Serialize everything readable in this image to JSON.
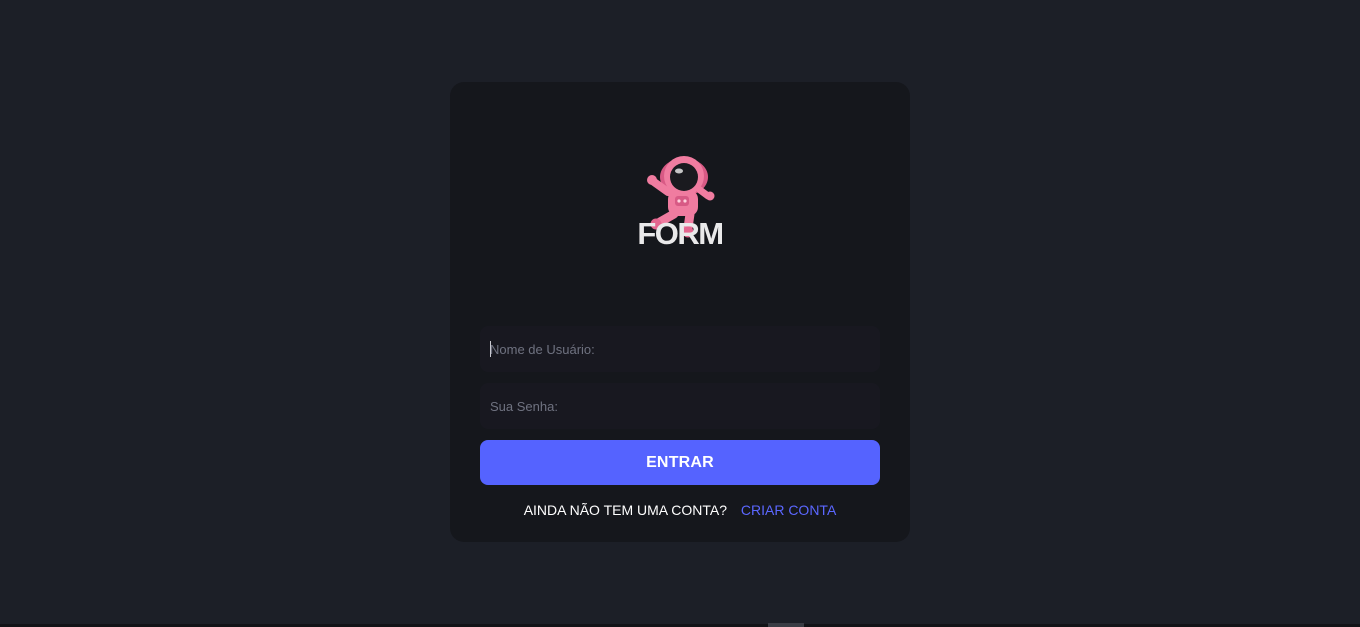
{
  "logo": {
    "icon": "astronaut-icon",
    "text": "FORM",
    "accent_color": "#f07ca0"
  },
  "form": {
    "username_placeholder": "Nome de Usuário:",
    "password_placeholder": "Sua Senha:",
    "submit_label": "ENTRAR",
    "submit_color": "#5563ff"
  },
  "signup": {
    "question": "AINDA NÃO TEM UMA CONTA?",
    "link_label": "CRIAR CONTA"
  }
}
